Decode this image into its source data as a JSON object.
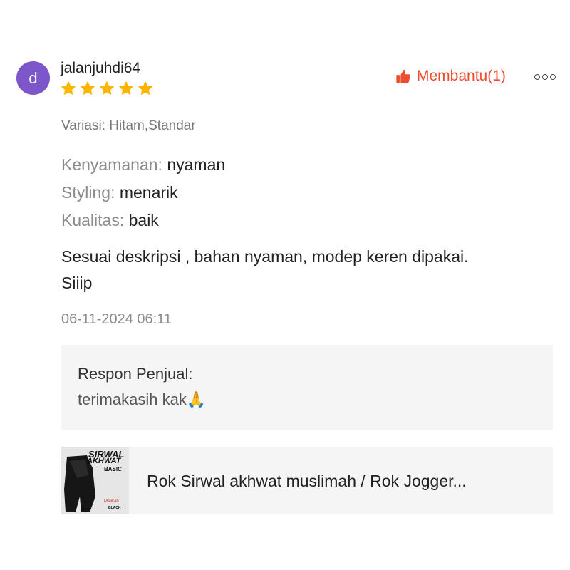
{
  "reviewer": {
    "avatar_letter": "d",
    "avatar_color": "#7d56c9",
    "username": "jalanjuhdi64",
    "rating": 5,
    "rating_max": 5,
    "star_color": "#ffb400"
  },
  "actions": {
    "helpful_label": "Membantu(1)",
    "helpful_icon": "thumbs-up-icon",
    "more_icon": "more-options-icon",
    "accent_color": "#ee4d2d"
  },
  "review": {
    "variant": "Variasi: Hitam,Standar",
    "attributes": [
      {
        "key": "Kenyamanan:",
        "value": "nyaman"
      },
      {
        "key": "Styling:",
        "value": "menarik"
      },
      {
        "key": "Kualitas:",
        "value": "baik"
      }
    ],
    "comment_line1": "Sesuai deskripsi , bahan nyaman, modep keren dipakai.",
    "comment_line2": "Siiip",
    "date": "06-11-2024 06:11"
  },
  "seller_response": {
    "title": "Respon Penjual:",
    "text": "terimakasih kak🙏"
  },
  "product": {
    "thumbnail_text_1": "SIRWAL",
    "thumbnail_text_2": "AKHWAT",
    "thumbnail_text_3": "BASIC",
    "thumbnail_text_4": "Malikah",
    "thumbnail_text_5": "BLACK",
    "title": "Rok Sirwal akhwat muslimah / Rok Jogger..."
  }
}
